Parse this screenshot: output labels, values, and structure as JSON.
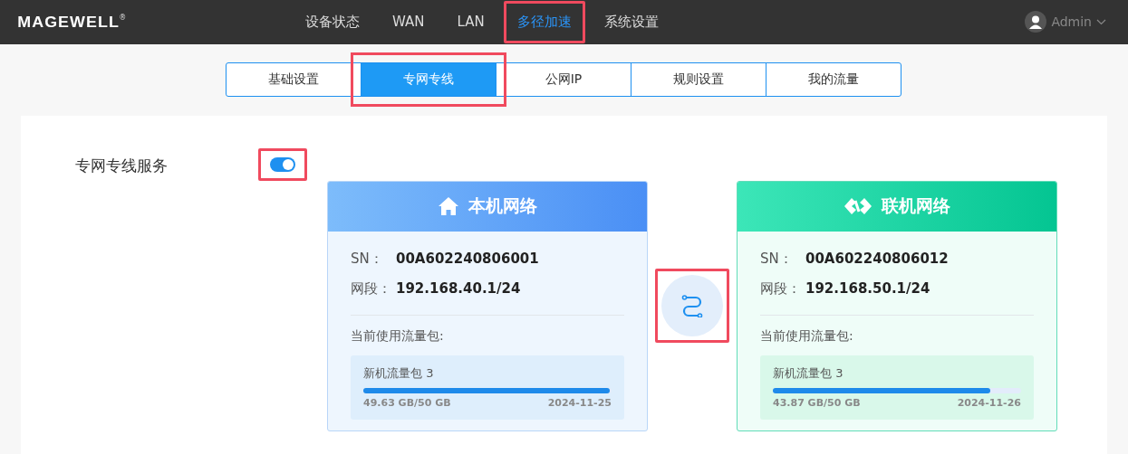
{
  "header": {
    "logo": "MAGEWELL",
    "logo_mark": "®",
    "nav": [
      {
        "label": "设备状态",
        "selected": false,
        "highlighted": false
      },
      {
        "label": "WAN",
        "selected": false,
        "highlighted": false
      },
      {
        "label": "LAN",
        "selected": false,
        "highlighted": false
      },
      {
        "label": "多径加速",
        "selected": true,
        "highlighted": true
      },
      {
        "label": "系统设置",
        "selected": false,
        "highlighted": false
      }
    ],
    "user": "Admin"
  },
  "tabs": [
    {
      "label": "基础设置",
      "selected": false,
      "highlighted": false
    },
    {
      "label": "专网专线",
      "selected": true,
      "highlighted": true
    },
    {
      "label": "公网IP",
      "selected": false,
      "highlighted": false
    },
    {
      "label": "规则设置",
      "selected": false,
      "highlighted": false
    },
    {
      "label": "我的流量",
      "selected": false,
      "highlighted": false
    }
  ],
  "service": {
    "label": "专网专线服务",
    "on": true,
    "highlighted": true
  },
  "link_highlighted": true,
  "networks": [
    {
      "kind": "local",
      "title": "本机网络",
      "sn_label": "SN：",
      "sn": "00A602240806001",
      "segment_label": "网段：",
      "segment": "192.168.40.1/24",
      "package_label": "当前使用流量包:",
      "package": "新机流量包 3",
      "level": 0.993,
      "usage": "49.63 GB/50 GB",
      "date": "2024-11-25"
    },
    {
      "kind": "peer",
      "title": "联机网络",
      "sn_label": "SN：",
      "sn": "00A602240806012",
      "segment_label": "网段：",
      "segment": "192.168.50.1/24",
      "package_label": "当前使用流量包:",
      "package": "新机流量包 3",
      "level": 0.877,
      "usage": "43.87 GB/50 GB",
      "date": "2024-11-26"
    }
  ]
}
